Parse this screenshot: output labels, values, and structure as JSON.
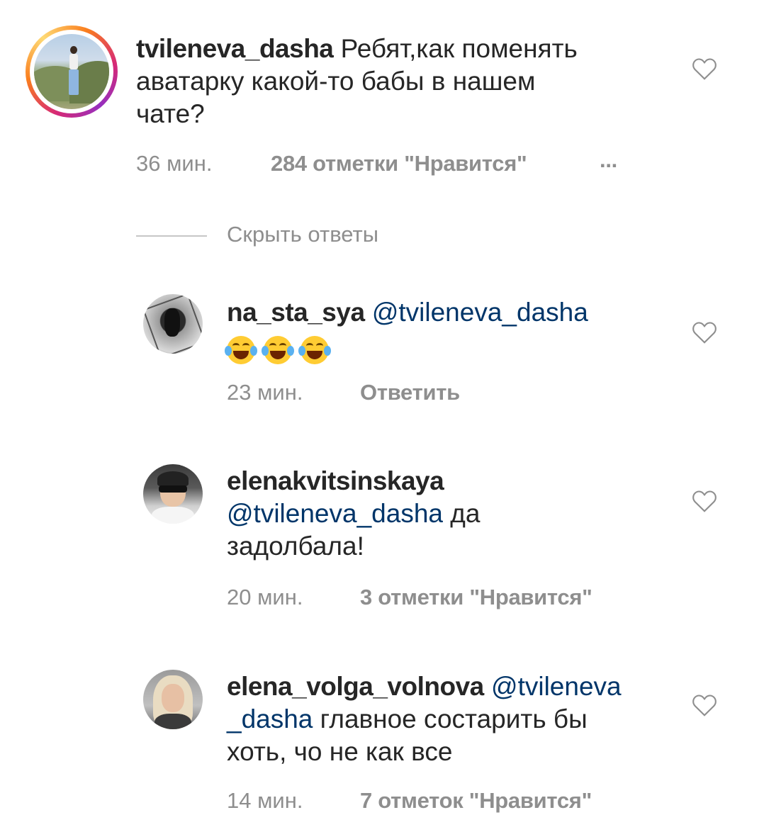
{
  "comments": [
    {
      "username": "tvileneva_dasha",
      "text_lines": [
        "Ребят,как поменять",
        "аватарку какой-то бабы в нашем",
        "чате?"
      ],
      "time": "36 мин.",
      "likes": "284 отметки \"Нравится\"",
      "more": "...",
      "avatar_icon": "user-avatar-story"
    },
    {
      "username": "na_sta_sya",
      "mention": "@tvileneva_dasha",
      "emoji": [
        "face-with-tears-of-joy",
        "face-with-tears-of-joy",
        "face-with-tears-of-joy"
      ],
      "time": "23 мин.",
      "action": "Ответить"
    },
    {
      "username": "elenakvitsinskaya",
      "mention": "@tvileneva_dasha",
      "text_after_mention": " да",
      "text_line2": "задолбала!",
      "time": "20 мин.",
      "likes": "3 отметки \"Нравится\""
    },
    {
      "username": "elena_volga_volnova",
      "mention_part1": "@tvileneva",
      "mention_part2": "_dasha",
      "text_after_mention": " главное состарить бы",
      "text_line3": "хоть, чо не как все",
      "time": "14 мин.",
      "likes": "7 отметок \"Нравится\""
    }
  ],
  "replies_toggle": "Скрыть ответы",
  "colors": {
    "text": "#262626",
    "mention": "#003569",
    "meta": "#8e8e8e",
    "background": "#ffffff"
  }
}
